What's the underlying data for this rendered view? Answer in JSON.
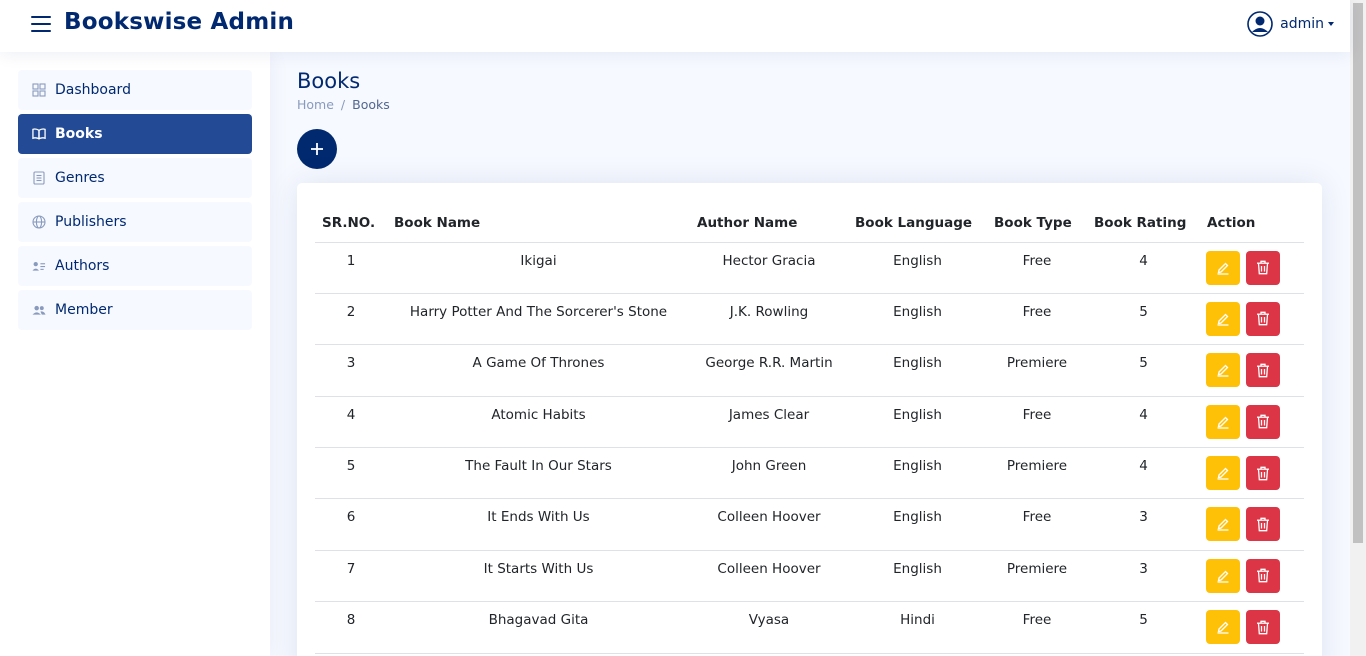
{
  "header": {
    "brand": "Bookswise Admin",
    "user": "admin"
  },
  "sidebar": {
    "items": [
      {
        "label": "Dashboard",
        "icon": "grid-icon"
      },
      {
        "label": "Books",
        "icon": "book-open-icon",
        "active": true
      },
      {
        "label": "Genres",
        "icon": "document-list-icon"
      },
      {
        "label": "Publishers",
        "icon": "globe-icon"
      },
      {
        "label": "Authors",
        "icon": "person-lines-icon"
      },
      {
        "label": "Member",
        "icon": "people-icon"
      }
    ]
  },
  "page": {
    "title": "Books",
    "breadcrumb": [
      "Home",
      "Books"
    ]
  },
  "table": {
    "headers": [
      "SR.NO.",
      "Book Name",
      "Author Name",
      "Book Language",
      "Book Type",
      "Book Rating",
      "Action"
    ],
    "rows": [
      {
        "no": "1",
        "name": "Ikigai",
        "author": "Hector Gracia",
        "language": "English",
        "type": "Free",
        "rating": "4"
      },
      {
        "no": "2",
        "name": "Harry Potter And The Sorcerer's Stone",
        "author": "J.K. Rowling",
        "language": "English",
        "type": "Free",
        "rating": "5"
      },
      {
        "no": "3",
        "name": "A Game Of Thrones",
        "author": "George R.R. Martin",
        "language": "English",
        "type": "Premiere",
        "rating": "5"
      },
      {
        "no": "4",
        "name": "Atomic Habits",
        "author": "James Clear",
        "language": "English",
        "type": "Free",
        "rating": "4"
      },
      {
        "no": "5",
        "name": "The Fault In Our Stars",
        "author": "John Green",
        "language": "English",
        "type": "Premiere",
        "rating": "4"
      },
      {
        "no": "6",
        "name": "It Ends With Us",
        "author": "Colleen Hoover",
        "language": "English",
        "type": "Free",
        "rating": "3"
      },
      {
        "no": "7",
        "name": "It Starts With Us",
        "author": "Colleen Hoover",
        "language": "English",
        "type": "Premiere",
        "rating": "3"
      },
      {
        "no": "8",
        "name": "Bhagavad Gita",
        "author": "Vyasa",
        "language": "Hindi",
        "type": "Free",
        "rating": "5"
      }
    ]
  },
  "colors": {
    "brand": "#012970",
    "active_nav": "#234a94",
    "edit": "#ffc107",
    "delete": "#dc3545"
  }
}
